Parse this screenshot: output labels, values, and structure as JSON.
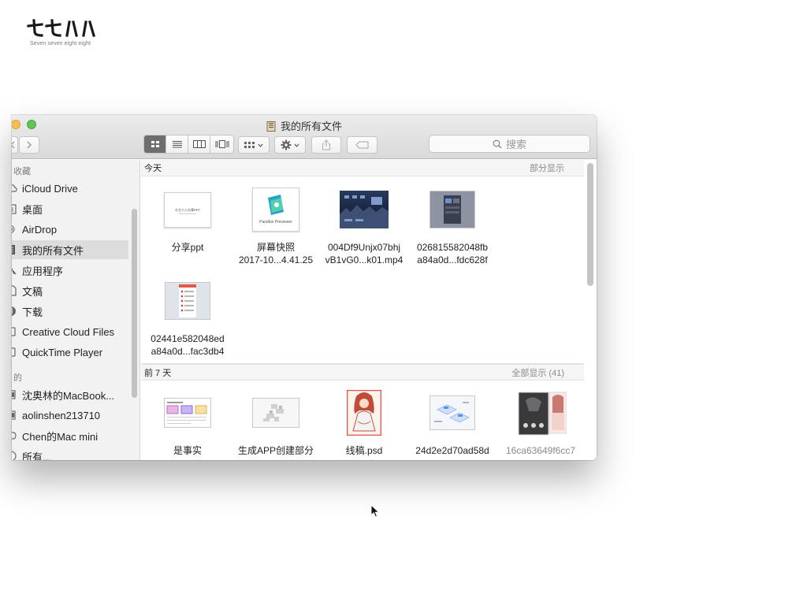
{
  "logo": {
    "brand_alt": "七七八八",
    "tagline": "Seven seven eight eight"
  },
  "window": {
    "title": "我的所有文件",
    "title_icon": "all-my-files-icon",
    "toolbar": {
      "view_modes": [
        "icon-view",
        "list-view",
        "column-view",
        "cover-flow-view"
      ],
      "active_view": "icon-view",
      "search_placeholder": "搜索"
    }
  },
  "sidebar": {
    "favorites_header": "收藏",
    "favorites": [
      {
        "label": "iCloud Drive",
        "icon": "cloud-icon"
      },
      {
        "label": "桌面",
        "icon": "desktop-icon"
      },
      {
        "label": "AirDrop",
        "icon": "airdrop-icon"
      },
      {
        "label": "我的所有文件",
        "icon": "all-my-files-icon",
        "active": true
      },
      {
        "label": "应用程序",
        "icon": "applications-icon"
      },
      {
        "label": "文稿",
        "icon": "documents-icon"
      },
      {
        "label": "下载",
        "icon": "downloads-icon"
      },
      {
        "label": "Creative Cloud Files",
        "icon": "creative-cloud-icon"
      },
      {
        "label": "QuickTime Player",
        "icon": "quicktime-icon"
      }
    ],
    "shared_header": "的",
    "shared": [
      {
        "label": "沈奥林的MacBook...",
        "icon": "laptop-icon"
      },
      {
        "label": "aolinshen213710",
        "icon": "computer-icon"
      },
      {
        "label": "Chen的Mac mini",
        "icon": "mac-mini-icon"
      },
      {
        "label": "所有...",
        "icon": "network-icon"
      }
    ]
  },
  "sections": [
    {
      "title": "今天",
      "more": "部分显示",
      "files": [
        {
          "name": [
            "分享ppt"
          ],
          "thumb": "ppt",
          "thumb_text": "七七八八分享PPT"
        },
        {
          "name": [
            "屏幕快照",
            "2017-10...4.41.25"
          ],
          "thumb": "screenshot",
          "thumb_text": "Parallax Previewer"
        },
        {
          "name": [
            "004Df9Unjx07bhj",
            "vB1vG0...k01.mp4"
          ],
          "thumb": "video"
        },
        {
          "name": [
            "026815582048fb",
            "a84a0d...fdc628f"
          ],
          "thumb": "image-dark"
        },
        {
          "name": [
            "02441e582048ed",
            "a84a0d...fac3db4"
          ],
          "thumb": "image-list"
        }
      ]
    },
    {
      "title": "前 7 天",
      "more": "全部显示 (41)",
      "files": [
        {
          "name": [
            "是事实"
          ],
          "thumb": "sheet"
        },
        {
          "name": [
            "生成APP创建部分"
          ],
          "thumb": "blurred"
        },
        {
          "name": [
            "线稿.psd"
          ],
          "thumb": "illustration"
        },
        {
          "name": [
            "24d2e2d70ad58d"
          ],
          "thumb": "isometric"
        },
        {
          "name": [
            "16ca63649f6cc7"
          ],
          "thumb": "stack",
          "faded": true
        }
      ]
    }
  ],
  "colors": {
    "traffic_yellow": "#f5be4f",
    "traffic_green": "#5fc454",
    "sidebar_bg": "#f2f2f3",
    "sidebar_active": "#dcdcdc",
    "section_header_bg": "#f5f5f5"
  }
}
